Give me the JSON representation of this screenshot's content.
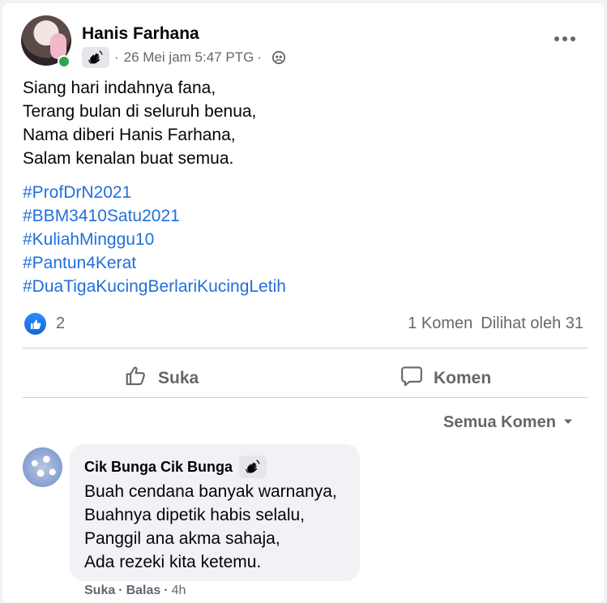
{
  "post": {
    "author": "Hanis Farhana",
    "date": "26 Mei jam 5:47 PTG",
    "separator": "·",
    "lines": [
      "Siang hari indahnya fana,",
      "Terang bulan di seluruh benua,",
      "Nama diberi Hanis Farhana,",
      "Salam kenalan buat semua."
    ],
    "hashtags": [
      "#ProfDrN2021",
      "#BBM3410Satu2021",
      "#KuliahMinggu10",
      "#Pantun4Kerat",
      "#DuaTigaKucingBerlariKucingLetih"
    ]
  },
  "stats": {
    "reaction_count": "2",
    "comments": "1 Komen",
    "views": "Dilihat oleh 31"
  },
  "actions": {
    "like": "Suka",
    "comment": "Komen"
  },
  "sort": {
    "label": "Semua Komen"
  },
  "comment": {
    "author": "Cik Bunga Cik Bunga",
    "lines": [
      "Buah cendana banyak warnanya,",
      "Buahnya dipetik habis selalu,",
      "Panggil ana akma sahaja,",
      "Ada rezeki kita ketemu."
    ],
    "like": "Suka",
    "sep1": "·",
    "reply": "Balas",
    "sep2": "·",
    "time": "4h"
  },
  "colors": {
    "link": "#216fdb",
    "secondary_text": "#65676b",
    "like_blue": "#1877f2",
    "online": "#31a24c"
  },
  "icons": {
    "badge": "wave-hand-icon",
    "privacy": "friends-globe-icon",
    "like": "thumbs-up-icon",
    "comment": "speech-bubble-icon",
    "sort": "caret-down-icon",
    "more": "more-dots-icon"
  }
}
